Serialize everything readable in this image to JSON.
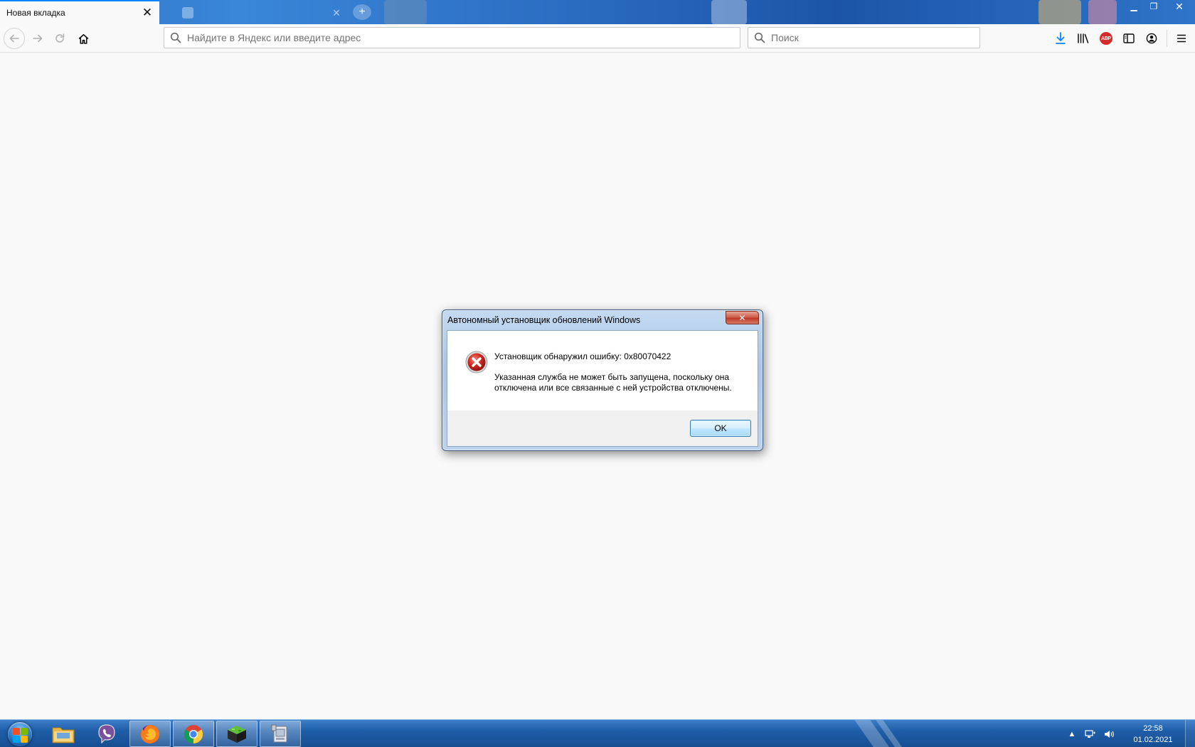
{
  "browser": {
    "tabs": [
      {
        "title": "Новая вкладка",
        "active": true
      },
      {
        "title": "",
        "active": false
      }
    ],
    "url_placeholder": "Найдите в Яндекс или введите адрес",
    "search_placeholder": "Поиск",
    "accent": "#0a84ff"
  },
  "dialog": {
    "title": "Автономный установщик обновлений Windows",
    "heading": "Установщик обнаружил ошибку: 0x80070422",
    "message": "Указанная служба не может быть запущена, поскольку она отключена или все связанные с ней устройства отключены.",
    "ok_label": "OK",
    "icon": "error-icon"
  },
  "taskbar": {
    "apps": [
      "file-explorer-icon",
      "viber-icon",
      "firefox-icon",
      "chrome-icon",
      "minecraft-icon",
      "installer-icon"
    ],
    "clock_time": "22:58",
    "clock_date": "01.02.2021"
  }
}
